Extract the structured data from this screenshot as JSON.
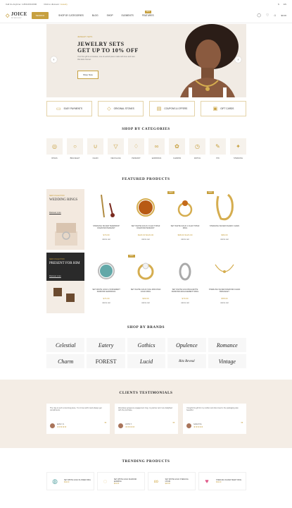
{
  "topbar": {
    "left1": "Call Us Anytime: 1-800-000-0000",
    "left2": "Click to discover:",
    "left2_link": "Jewelry",
    "right": [
      "$",
      "EN"
    ]
  },
  "header": {
    "logo": "JOICE",
    "logo_sub": "JEWELRY",
    "search": "SEARCH",
    "nav": [
      "SHOP BY CATEGORIES",
      "BLOG",
      "SHOP",
      "ELEMENTS",
      "FEATURES"
    ],
    "nav_badge": "NEW",
    "cart_total": "$0.00",
    "icons": [
      "user-icon",
      "heart-icon",
      "cart-icon"
    ]
  },
  "hero": {
    "eyebrow": "JEWELRY SETS",
    "title_line1": "JEWELRY SETS",
    "title_line2": "GET UP TO 10% OFF",
    "desc": "Your fine gift is a timeless, one-of-a-kind piece made with love and care that lasts forever.",
    "button": "Shop Now"
  },
  "features": [
    {
      "label": "EASY PAYMENTS",
      "icon": "card-icon"
    },
    {
      "label": "ORIGINAL STONES",
      "icon": "gem-icon"
    },
    {
      "label": "COUPONS & OFFERS",
      "icon": "ticket-icon"
    },
    {
      "label": "GIFT CARDS",
      "icon": "gift-icon"
    }
  ],
  "categories": {
    "title": "SHOP BY CATEGORIES",
    "items": [
      "RINGS",
      "BRACELET",
      "CHAIN",
      "NECKLACE",
      "PENDANT",
      "EARRINGS",
      "CHARMS",
      "WATCH",
      "PIN",
      "STERLING"
    ]
  },
  "featured": {
    "title": "FEATURED PRODUCTS",
    "promo1": {
      "eyebrow": "NEW COLLECTION",
      "title": "WEDDING RINGS",
      "link": "Discover more"
    },
    "promo2": {
      "eyebrow": "NEW COLLECTION",
      "title": "PRESENT FOR HIM",
      "link": "Discover more"
    },
    "row1": [
      {
        "name": "STERLING SILVER TEARDROP DIAMOND PENDANT",
        "price": "$79.00",
        "badge": ""
      },
      {
        "name": "SET WHITE GOLD 2 CLEF TOPAZ DIAMOND PENDANT",
        "price": "$118.00 $129.00",
        "badge": ""
      },
      {
        "name": "SET WHITE GOLD 1 CLEF TOPAZ RING",
        "price": "$98.00 $123.00",
        "badge": "SALE"
      },
      {
        "name": "STERLING SILVER FIGARO CHAIN",
        "price": "$89.00",
        "badge": "SALE"
      }
    ],
    "row2": [
      {
        "name": "SET WHITE GOLD 2 DIFFERENT DIAMOND EARRINGS",
        "price": "$74.00",
        "badge": ""
      },
      {
        "name": "SET WHITE GOLD OVAL ZIRCONIA GOLD RING",
        "price": "$99.00",
        "badge": "SALE"
      },
      {
        "name": "SET WHITE GOLD BAGUETTE DIAMOND ENGAGEMENT RING",
        "price": "$79.00",
        "badge": ""
      },
      {
        "name": "STERLING SILVER DIAMOND CHAIN BRACELET",
        "price": "$58.00",
        "badge": ""
      }
    ],
    "add_to_cart": "Add to cart"
  },
  "brands": {
    "title": "SHOP BY BRANDS",
    "items": [
      "Celestial",
      "Eatery",
      "Gothics",
      "Opulence",
      "Romance",
      "Charm",
      "FOREST",
      "Lucid",
      "Ritz Reveal",
      "Vintage"
    ]
  },
  "testimonials": {
    "title": "CLIENTS TESTIMONIALS",
    "items": [
      {
        "text": "The ring is such a stunning piece, I'm in love with it and always get compliments.",
        "name": "EMILY D.",
        "role": "Customer"
      },
      {
        "text": "Absolutely gorgeous engagement ring, my partner and I are delighted with the purchase.",
        "name": "JOHN T.",
        "role": "Customer"
      },
      {
        "text": "I bought the gift for my mother and she loved it, the packaging was beautiful.",
        "name": "SARAH M.",
        "role": "Customer"
      }
    ]
  },
  "trending": {
    "title": "TRENDING PRODUCTS",
    "items": [
      {
        "name": "SET WHITE GOLD FLOWER RING",
        "price": "$19.00"
      },
      {
        "name": "SET WHITE GOLD DIAMOND EARRING",
        "price": "$19.00"
      },
      {
        "name": "SET WHITE GOLD STERLING CHAIN",
        "price": "$26.00"
      },
      {
        "name": "STERLING SILVER HEART RING",
        "price": "$19.00"
      }
    ]
  }
}
